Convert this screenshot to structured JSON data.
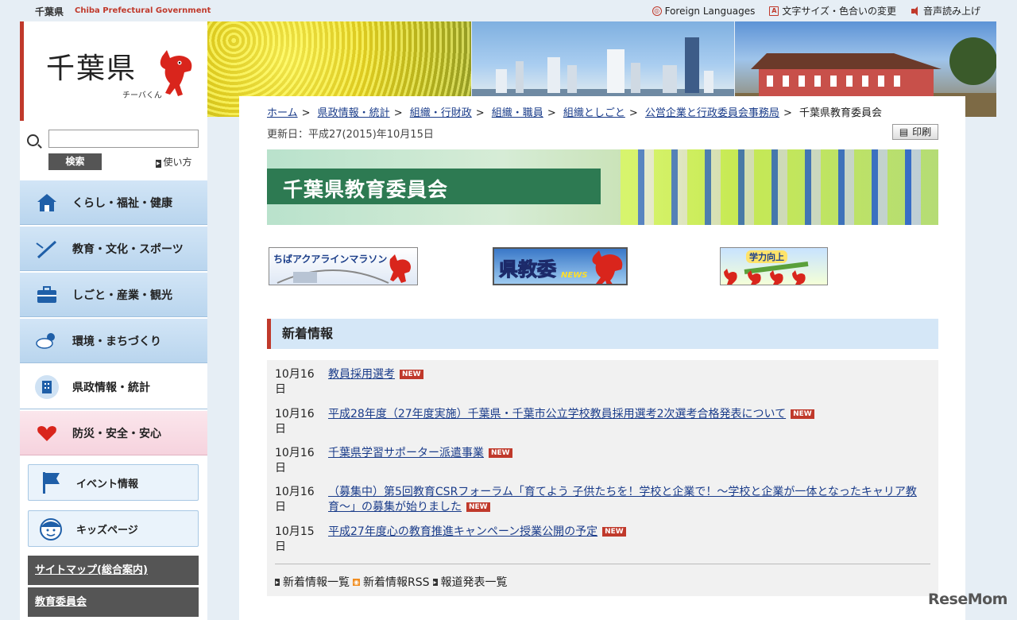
{
  "header": {
    "pref_name": "千葉県",
    "pref_name_en": "Chiba Prefectural Government",
    "links": [
      {
        "label": "Foreign Languages",
        "icon": "globe-icon"
      },
      {
        "label": "文字サイズ・色合いの変更",
        "icon": "text-size-icon"
      },
      {
        "label": "音声読み上げ",
        "icon": "speaker-icon"
      }
    ]
  },
  "logo": {
    "title": "千葉県",
    "mascot_caption": "チーバくん"
  },
  "search": {
    "value": "",
    "button": "検索",
    "help": "使い方"
  },
  "nav": [
    {
      "label": "くらし・福祉・健康",
      "icon": "house-icon"
    },
    {
      "label": "教育・文化・スポーツ",
      "icon": "pen-icon"
    },
    {
      "label": "しごと・産業・観光",
      "icon": "briefcase-icon"
    },
    {
      "label": "環境・まちづくり",
      "icon": "weather-icon"
    },
    {
      "label": "県政情報・統計",
      "icon": "building-icon"
    },
    {
      "label": "防災・安全・安心",
      "icon": "heart-icon"
    }
  ],
  "sub_nav": [
    {
      "label": "イベント情報",
      "icon": "flag-icon"
    },
    {
      "label": "キッズページ",
      "icon": "kid-face-icon"
    }
  ],
  "dark_links": [
    "サイトマップ(総合案内)",
    "教育委員会"
  ],
  "breadcrumb": [
    "ホーム",
    "県政情報・統計",
    "組織・行財政",
    "組織・職員",
    "組織としごと",
    "公営企業と行政委員会事務局"
  ],
  "breadcrumb_current": "千葉県教育委員会",
  "updated": "更新日：平成27(2015)年10月15日",
  "print_label": "印刷",
  "page_title": "千葉県教育委員会",
  "banners": {
    "marathon": "ちばアクアラインマラソン",
    "news_main": "県教委",
    "news_sub": "NEWS",
    "study": "学力向上"
  },
  "news": {
    "heading": "新着情報",
    "new_badge": "NEW",
    "items": [
      {
        "date": "10月16日",
        "title": "教員採用選考"
      },
      {
        "date": "10月16日",
        "title": "平成28年度（27年度実施）千葉県・千葉市公立学校教員採用選考2次選考合格発表について"
      },
      {
        "date": "10月16日",
        "title": "千葉県学習サポーター派遣事業"
      },
      {
        "date": "10月16日",
        "title": "（募集中）第5回教育CSRフォーラム「育てよう 子供たちを！学校と企業で！～学校と企業が一体となったキャリア教育～」の募集が始りました"
      },
      {
        "date": "10月15日",
        "title": "平成27年度心の教育推進キャンペーン授業公開の予定"
      }
    ],
    "footer": [
      "新着情報一覧",
      "新着情報RSS",
      "報道発表一覧"
    ]
  },
  "watermark": "ReseMom"
}
